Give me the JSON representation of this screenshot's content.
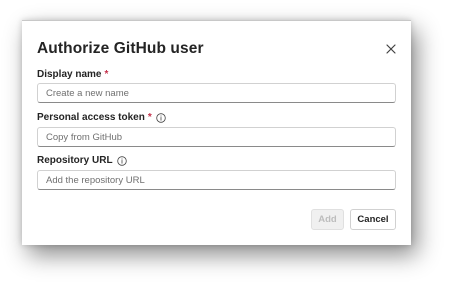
{
  "dialog": {
    "title": "Authorize GitHub user",
    "close_icon": "close-icon",
    "fields": [
      {
        "label": "Display name",
        "required_marker": "*",
        "placeholder": "Create a new name",
        "value": ""
      },
      {
        "label": "Personal access token",
        "required_marker": "*",
        "info_icon": "info-icon",
        "placeholder": "Copy from GitHub",
        "value": ""
      },
      {
        "label": "Repository URL",
        "info_icon": "info-icon",
        "placeholder": "Add the repository URL",
        "value": ""
      }
    ],
    "buttons": {
      "add_label": "Add",
      "cancel_label": "Cancel"
    }
  },
  "colors": {
    "required": "#c4314b",
    "disabled_text": "#bdbdbd",
    "text": "#242424"
  }
}
